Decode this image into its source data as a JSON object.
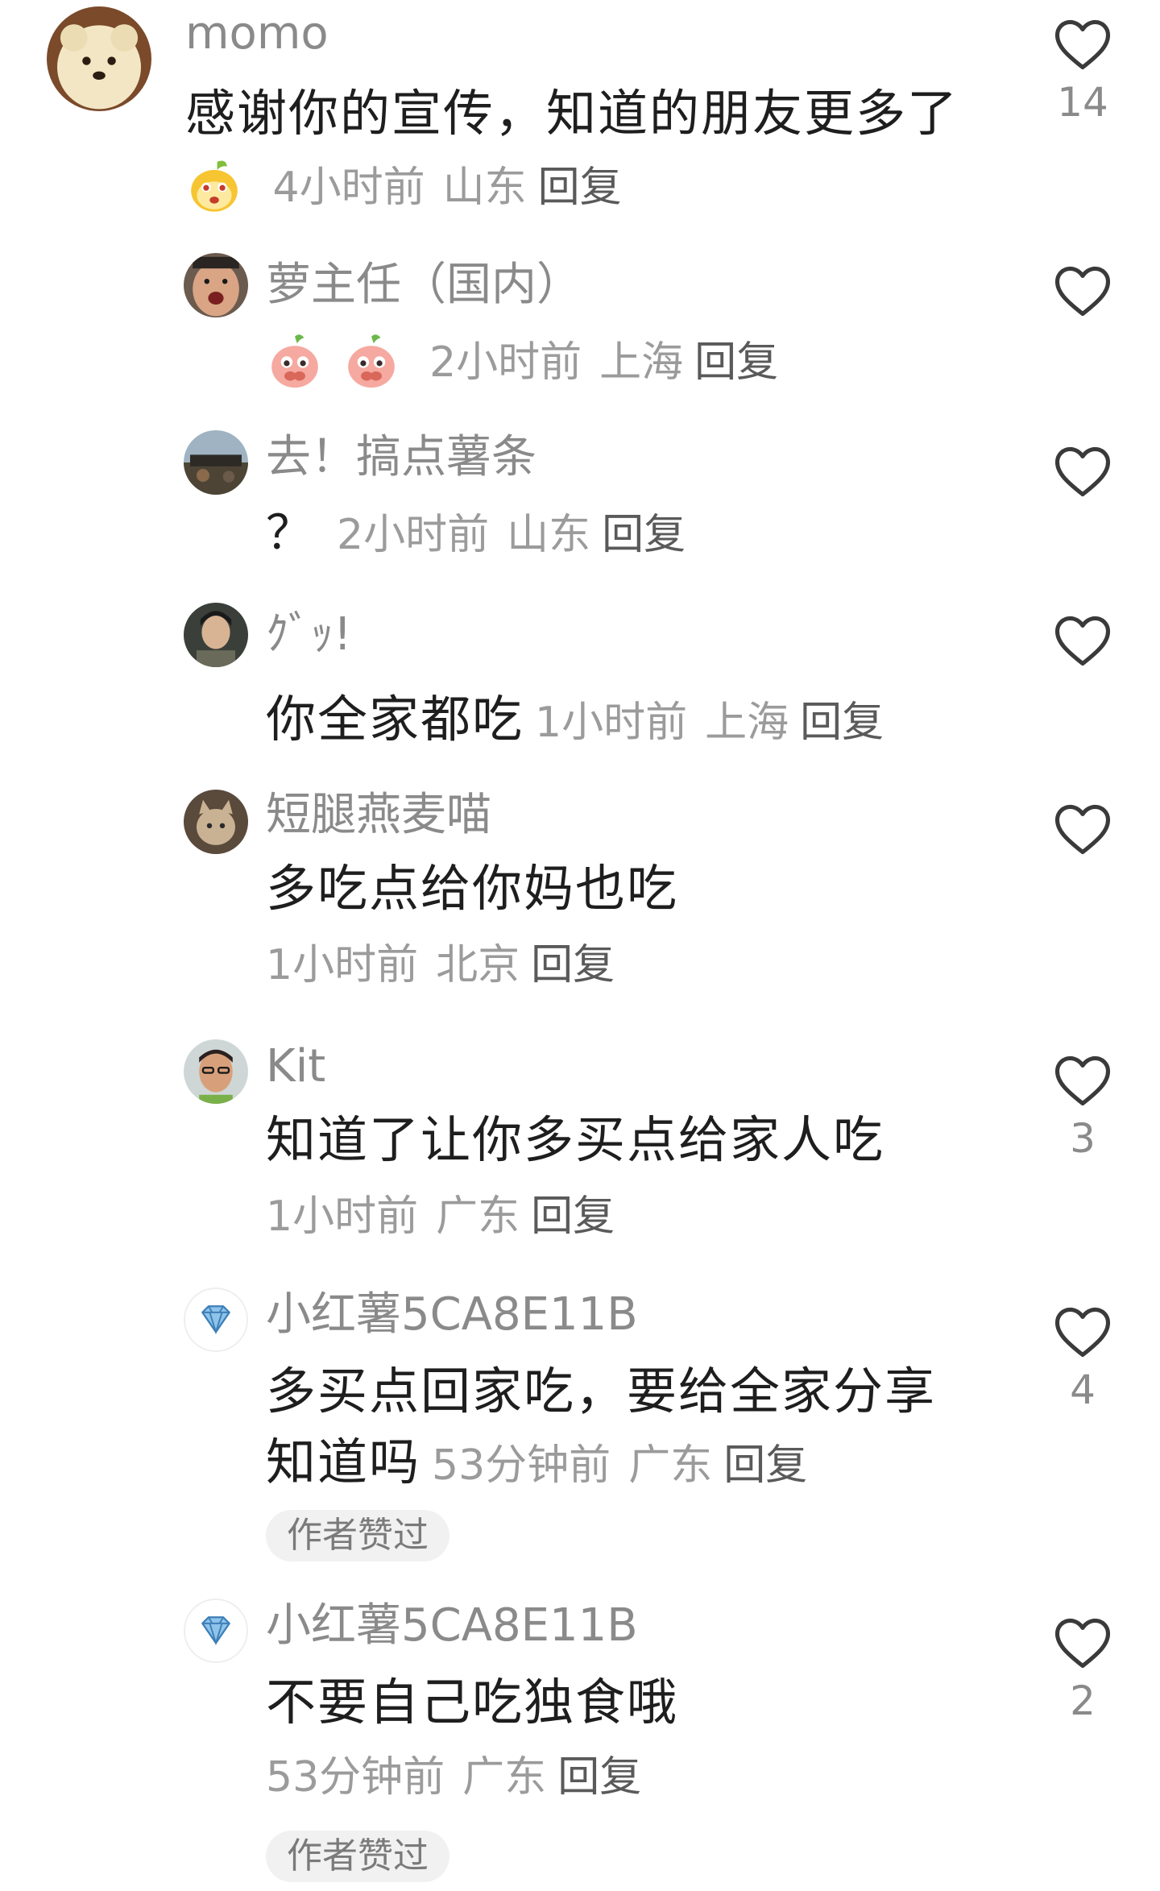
{
  "comments": [
    {
      "user": "momo",
      "text": "感谢你的宣传，知道的朋友更多了",
      "time": "4小时前",
      "location": "山东",
      "reply": "回复",
      "likes": "14",
      "emoji": "mascot-emoji"
    },
    {
      "user": "萝主任（国内）",
      "text": "",
      "time": "2小时前",
      "location": "上海",
      "reply": "回复",
      "likes": "",
      "emoji": "peach-crying-emoji"
    },
    {
      "user": "去！搞点薯条",
      "text": "？",
      "time": "2小时前",
      "location": "山东",
      "reply": "回复",
      "likes": ""
    },
    {
      "user": "ｸﾞｯ!",
      "text": "你全家都吃",
      "time": "1小时前",
      "location": "上海",
      "reply": "回复",
      "likes": ""
    },
    {
      "user": "短腿燕麦喵",
      "text": "多吃点给你妈也吃",
      "time": "1小时前",
      "location": "北京",
      "reply": "回复",
      "likes": ""
    },
    {
      "user": "Kit",
      "text": "知道了让你多买点给家人吃",
      "time": "1小时前",
      "location": "广东",
      "reply": "回复",
      "likes": "3"
    },
    {
      "user": "小红薯5CA8E11B",
      "text_line1": "多买点回家吃，要给全家分享",
      "text_line2": "知道吗",
      "time": "53分钟前",
      "location": "广东",
      "reply": "回复",
      "likes": "4",
      "badge": "作者赞过"
    },
    {
      "user": "小红薯5CA8E11B",
      "text": "不要自己吃独食哦",
      "time": "53分钟前",
      "location": "广东",
      "reply": "回复",
      "likes": "2",
      "badge": "作者赞过"
    }
  ],
  "icons": {
    "like": "heart-outline-icon",
    "verified": "diamond-icon"
  },
  "colors": {
    "name": "#8a8a8a",
    "text": "#1e1e1e",
    "meta": "#9b9b9b",
    "badge_bg": "#f1f1f1"
  }
}
